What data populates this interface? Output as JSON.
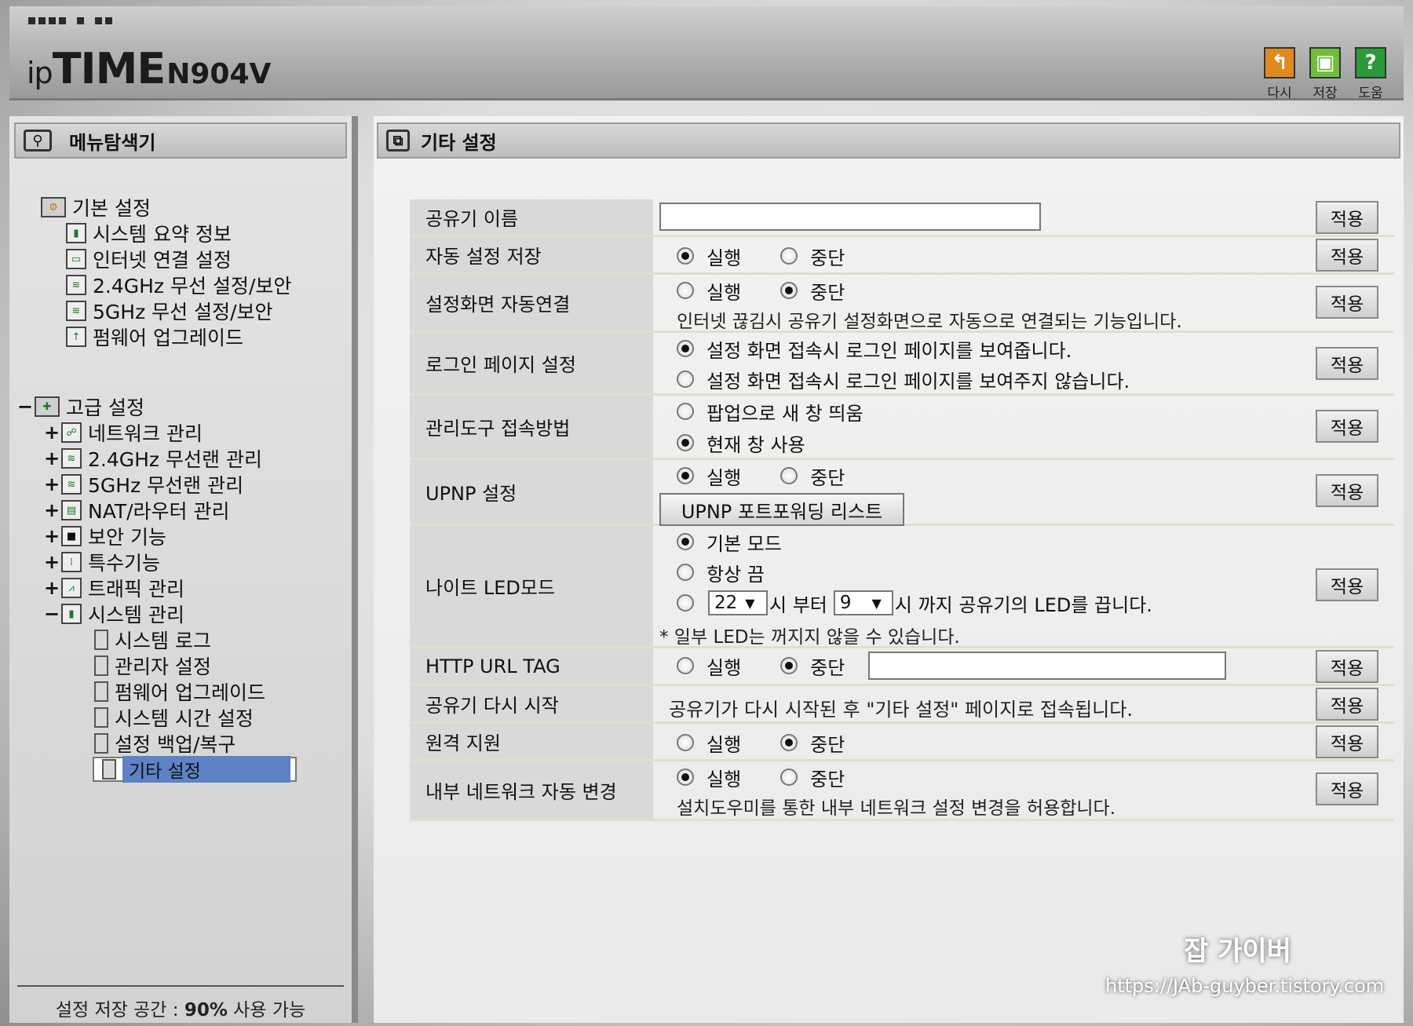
{
  "header": {
    "brand_ip": "ip",
    "brand_time": "TIME",
    "model": "N904V",
    "tools": [
      {
        "label": "다시",
        "icon": "undo-icon",
        "color": "#e08a1e"
      },
      {
        "label": "저장",
        "icon": "save-icon",
        "color": "#6fbf3a"
      },
      {
        "label": "도움",
        "icon": "help-icon",
        "color": "#2a9a3a"
      }
    ]
  },
  "sidebar": {
    "title": "메뉴탐색기",
    "basic": {
      "label": "기본 설정",
      "items": [
        "시스템 요약 정보",
        "인터넷 연결 설정",
        "2.4GHz 무선 설정/보안",
        "5GHz 무선 설정/보안",
        "펌웨어 업그레이드"
      ]
    },
    "advanced": {
      "toggle": "−",
      "label": "고급 설정",
      "items": [
        {
          "toggle": "+",
          "label": "네트워크 관리"
        },
        {
          "toggle": "+",
          "label": "2.4GHz 무선랜 관리"
        },
        {
          "toggle": "+",
          "label": "5GHz 무선랜 관리"
        },
        {
          "toggle": "+",
          "label": "NAT/라우터 관리"
        },
        {
          "toggle": "+",
          "label": "보안 기능"
        },
        {
          "toggle": "+",
          "label": "특수기능"
        },
        {
          "toggle": "+",
          "label": "트래픽 관리"
        },
        {
          "toggle": "−",
          "label": "시스템 관리"
        }
      ],
      "system_children": [
        "시스템 로그",
        "관리자 설정",
        "펌웨어 업그레이드",
        "시스템 시간 설정",
        "설정 백업/복구",
        "기타 설정"
      ]
    },
    "footer_prefix": "설정 저장 공간 : ",
    "footer_value": "90%",
    "footer_suffix": " 사용 가능"
  },
  "main": {
    "title": "기타 설정",
    "apply_label": "적용",
    "rows": {
      "router_name": {
        "label": "공유기 이름",
        "value": ""
      },
      "auto_save": {
        "label": "자동 설정 저장",
        "opt_on": "실행",
        "opt_off": "중단",
        "selected": "실행"
      },
      "auto_connect": {
        "label": "설정화면 자동연결",
        "opt_on": "실행",
        "opt_off": "중단",
        "selected": "중단",
        "desc": "인터넷 끊김시 공유기 설정화면으로 자동으로 연결되는 기능입니다."
      },
      "login_page": {
        "label": "로그인 페이지 설정",
        "opt1": "설정 화면 접속시 로그인 페이지를 보여줍니다.",
        "opt2": "설정 화면 접속시 로그인 페이지를 보여주지 않습니다.",
        "selected": 1
      },
      "admin_access": {
        "label": "관리도구 접속방법",
        "opt1": "팝업으로 새 창 띄움",
        "opt2": "현재 창 사용",
        "selected": 2
      },
      "upnp": {
        "label": "UPNP 설정",
        "opt_on": "실행",
        "opt_off": "중단",
        "selected": "실행",
        "button": "UPNP 포트포워딩 리스트"
      },
      "night_led": {
        "label": "나이트 LED모드",
        "opt1": "기본 모드",
        "opt2": "항상 끔",
        "from_value": "22",
        "from_text": "시 부터",
        "to_value": "9",
        "to_text": "시 까지 공유기의 LED를 끕니다.",
        "selected": 1,
        "note": "* 일부 LED는 꺼지지 않을 수 있습니다."
      },
      "http_url_tag": {
        "label": "HTTP URL TAG",
        "opt_on": "실행",
        "opt_off": "중단",
        "selected": "중단",
        "value": ""
      },
      "restart": {
        "label": "공유기 다시 시작",
        "desc": "공유기가 다시 시작된 후 \"기타 설정\" 페이지로 접속됩니다."
      },
      "remote_support": {
        "label": "원격 지원",
        "opt_on": "실행",
        "opt_off": "중단",
        "selected": "중단"
      },
      "internal_network": {
        "label": "내부 네트워크 자동 변경",
        "opt_on": "실행",
        "opt_off": "중단",
        "selected": "실행",
        "desc": "설치도우미를 통한 내부 네트워크 설정 변경을 허용합니다."
      }
    }
  },
  "watermark": {
    "name": "잡 가이버",
    "url": "https://JAb-guyber.tistory.com"
  }
}
